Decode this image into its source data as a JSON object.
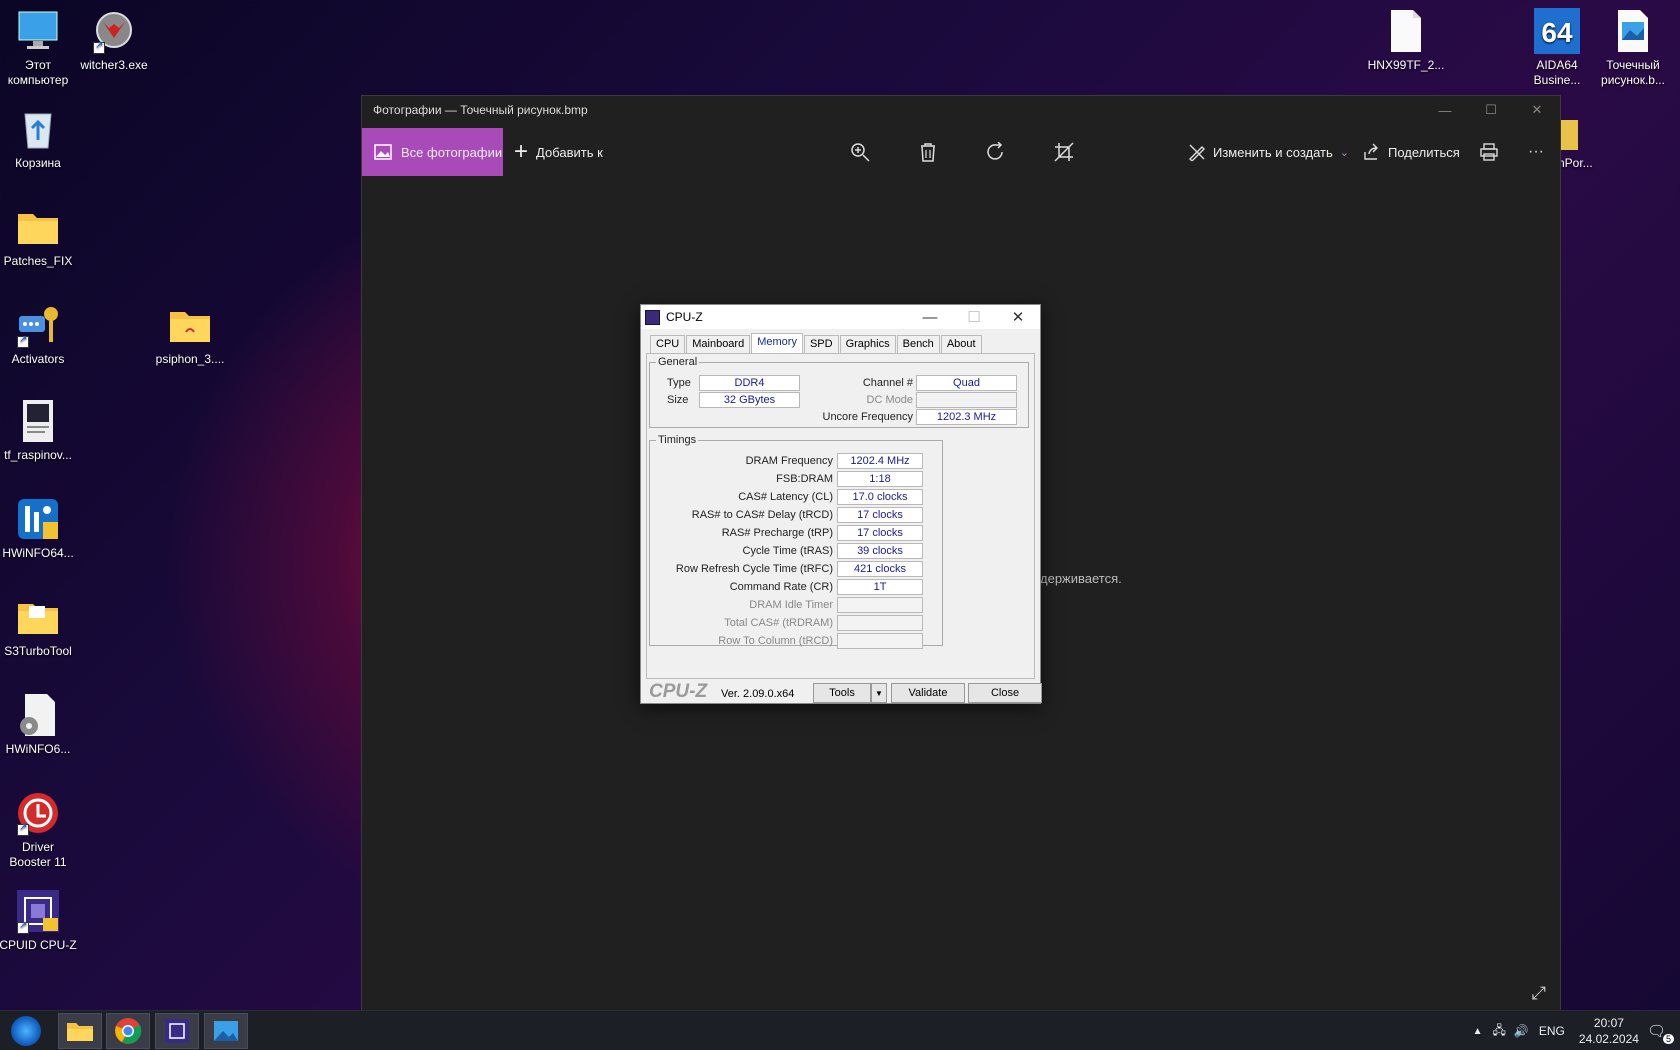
{
  "desktop": {
    "icons": [
      {
        "label": "Этот\nкомпьютер",
        "icon": "computer-icon"
      },
      {
        "label": "witcher3.exe",
        "icon": "witcher-icon"
      },
      {
        "label": "Корзина",
        "icon": "recycle-bin-icon"
      },
      {
        "label": "Patches_FIX",
        "icon": "folder-icon"
      },
      {
        "label": "Activators",
        "icon": "key-icon"
      },
      {
        "label": "psiphon_3....",
        "icon": "folder-icon"
      },
      {
        "label": "tf_raspinov...",
        "icon": "document-icon"
      },
      {
        "label": "HWiNFO64...",
        "icon": "hwinfo-icon"
      },
      {
        "label": "S3TurboTool",
        "icon": "folder-icon"
      },
      {
        "label": "HWiNFO6...",
        "icon": "settings-file-icon"
      },
      {
        "label": "Driver\nBooster 11",
        "icon": "driver-booster-icon"
      },
      {
        "label": "CPUID CPU-Z",
        "icon": "cpuz-icon"
      },
      {
        "label": "HNX99TF_2...",
        "icon": "blank-file-icon"
      },
      {
        "label": "AIDA64\nBusine...",
        "icon": "aida64-icon"
      },
      {
        "label": "Точечный\nрисунок.b...",
        "icon": "image-file-icon"
      },
      {
        "label": "nPor...",
        "icon": "folder-icon"
      }
    ]
  },
  "photos": {
    "title": "Фотографии — Точечный рисунок.bmp",
    "all_photos": "Все фотографии",
    "add_to": "Добавить к",
    "edit_create": "Изменить и создать",
    "share": "Поделиться",
    "more": "···",
    "message_fragment": "держивается."
  },
  "cpuz": {
    "title": "CPU-Z",
    "tabs": [
      "CPU",
      "Mainboard",
      "Memory",
      "SPD",
      "Graphics",
      "Bench",
      "About"
    ],
    "general": {
      "legend": "General",
      "type_label": "Type",
      "type_value": "DDR4",
      "size_label": "Size",
      "size_value": "32 GBytes",
      "channel_label": "Channel #",
      "channel_value": "Quad",
      "dcmode_label": "DC Mode",
      "dcmode_value": "",
      "uncore_label": "Uncore Frequency",
      "uncore_value": "1202.3 MHz"
    },
    "timings": {
      "legend": "Timings",
      "rows": [
        {
          "label": "DRAM Frequency",
          "value": "1202.4 MHz",
          "disabled": false
        },
        {
          "label": "FSB:DRAM",
          "value": "1:18",
          "disabled": false
        },
        {
          "label": "CAS# Latency (CL)",
          "value": "17.0 clocks",
          "disabled": false
        },
        {
          "label": "RAS# to CAS# Delay (tRCD)",
          "value": "17 clocks",
          "disabled": false
        },
        {
          "label": "RAS# Precharge (tRP)",
          "value": "17 clocks",
          "disabled": false
        },
        {
          "label": "Cycle Time (tRAS)",
          "value": "39 clocks",
          "disabled": false
        },
        {
          "label": "Row Refresh Cycle Time (tRFC)",
          "value": "421 clocks",
          "disabled": false
        },
        {
          "label": "Command Rate (CR)",
          "value": "1T",
          "disabled": false
        },
        {
          "label": "DRAM Idle Timer",
          "value": "",
          "disabled": true
        },
        {
          "label": "Total CAS# (tRDRAM)",
          "value": "",
          "disabled": true
        },
        {
          "label": "Row To Column (tRCD)",
          "value": "",
          "disabled": true
        }
      ]
    },
    "footer": {
      "logo": "CPU-Z",
      "version": "Ver. 2.09.0.x64",
      "tools": "Tools",
      "validate": "Validate",
      "close": "Close"
    }
  },
  "taskbar": {
    "apps": [
      "file-explorer-icon",
      "chrome-icon",
      "cpuz-icon",
      "photos-icon"
    ],
    "language": "ENG",
    "time": "20:07",
    "date": "24.02.2024",
    "notifications": "5"
  }
}
